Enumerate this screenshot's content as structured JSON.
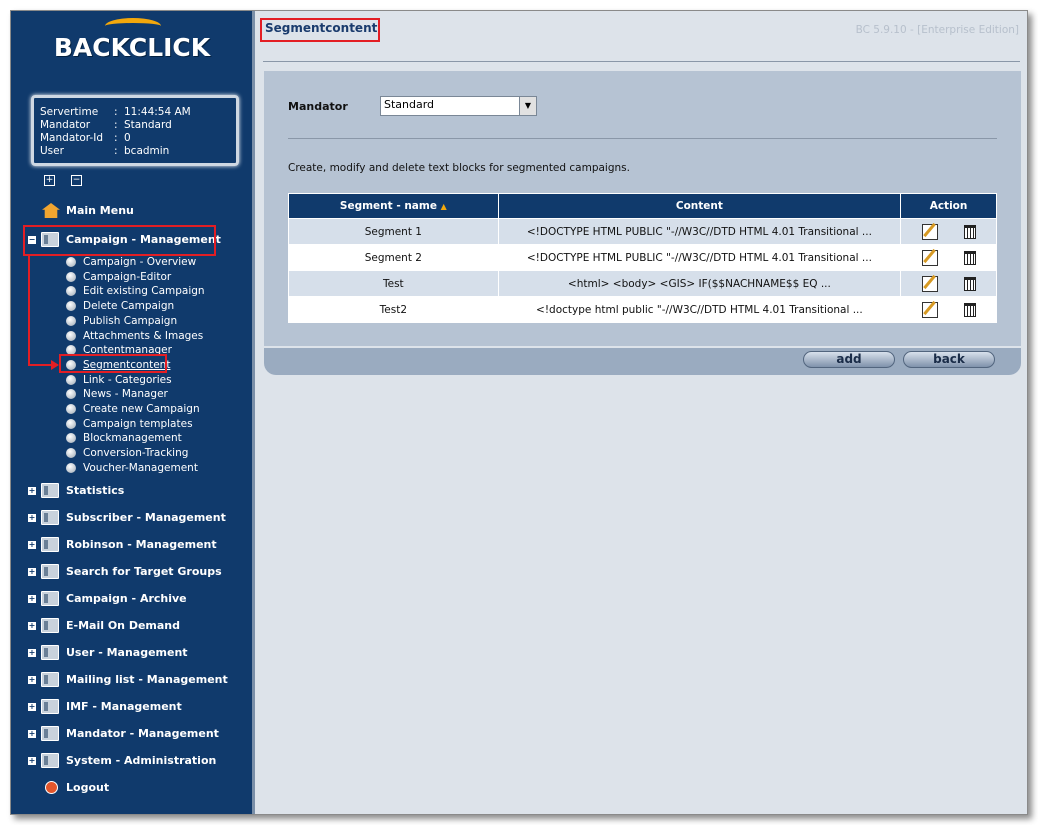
{
  "app": {
    "logo": "BACKCLICK",
    "version": "BC 5.9.10 - [Enterprise Edition]"
  },
  "session": {
    "rows": [
      {
        "key": "Servertime",
        "value": "11:44:54 AM"
      },
      {
        "key": "Mandator",
        "value": "Standard"
      },
      {
        "key": "Mandator-Id",
        "value": "0"
      },
      {
        "key": "User",
        "value": "bcadmin"
      }
    ]
  },
  "sidebar": {
    "expand_all": "+",
    "collapse_all": "−",
    "main_menu": "Main Menu",
    "campaign_management": "Campaign - Management",
    "campaign_items": [
      "Campaign - Overview",
      "Campaign-Editor",
      "Edit existing Campaign",
      "Delete Campaign",
      "Publish Campaign",
      "Attachments & Images",
      "Contentmanager",
      "Segmentcontent",
      "Link - Categories",
      "News - Manager",
      "Create new Campaign",
      "Campaign templates",
      "Blockmanagement",
      "Conversion-Tracking",
      "Voucher-Management"
    ],
    "sections": [
      "Statistics",
      "Subscriber - Management",
      "Robinson - Management",
      "Search for Target Groups",
      "Campaign - Archive",
      "E-Mail On Demand",
      "User - Management",
      "Mailing list - Management",
      "IMF - Management",
      "Mandator - Management",
      "System - Administration"
    ],
    "logout": "Logout"
  },
  "page": {
    "title": "Segmentcontent",
    "mandator_label": "Mandator",
    "mandator_value": "Standard",
    "description": "Create, modify and delete text blocks for segmented campaigns."
  },
  "table": {
    "headers": [
      "Segment - name",
      "Content",
      "Action"
    ],
    "rows": [
      {
        "name": "Segment 1",
        "content": "<!DOCTYPE HTML PUBLIC \"-//W3C//DTD HTML 4.01 Transitional ..."
      },
      {
        "name": "Segment 2",
        "content": "<!DOCTYPE HTML PUBLIC \"-//W3C//DTD HTML 4.01 Transitional ..."
      },
      {
        "name": "Test",
        "content": "<html> <body> <GIS> IF($$NACHNAME$$ EQ ..."
      },
      {
        "name": "Test2",
        "content": "<!doctype html public \"-//W3C//DTD HTML 4.01 Transitional ..."
      }
    ]
  },
  "buttons": {
    "add": "add",
    "back": "back"
  }
}
